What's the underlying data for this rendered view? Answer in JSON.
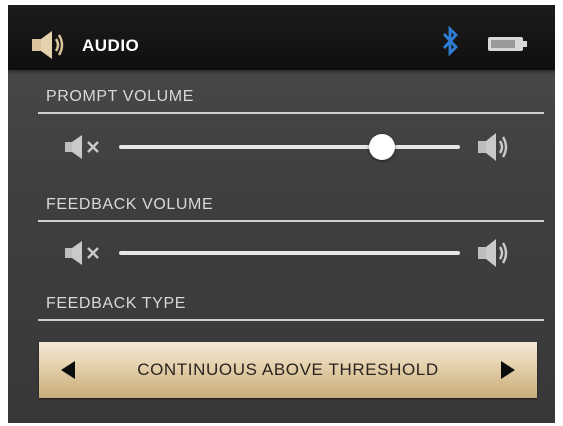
{
  "header": {
    "title": "AUDIO",
    "icons": [
      "speaker-icon",
      "bluetooth-icon",
      "battery-icon"
    ],
    "bluetooth_color": "#2f7fd6"
  },
  "prompt_volume": {
    "label": "PROMPT VOLUME",
    "level": 0.77,
    "min_icon": "mute-icon",
    "max_icon": "speaker-loud-icon"
  },
  "feedback_volume": {
    "label": "FEEDBACK VOLUME",
    "level": 1.0,
    "min_icon": "mute-icon",
    "max_icon": "speaker-loud-icon"
  },
  "feedback_type": {
    "label": "FEEDBACK TYPE",
    "value": "CONTINUOUS ABOVE THRESHOLD",
    "prev_icon": "triangle-left-icon",
    "next_icon": "triangle-right-icon",
    "accent": "#d9c39a"
  }
}
